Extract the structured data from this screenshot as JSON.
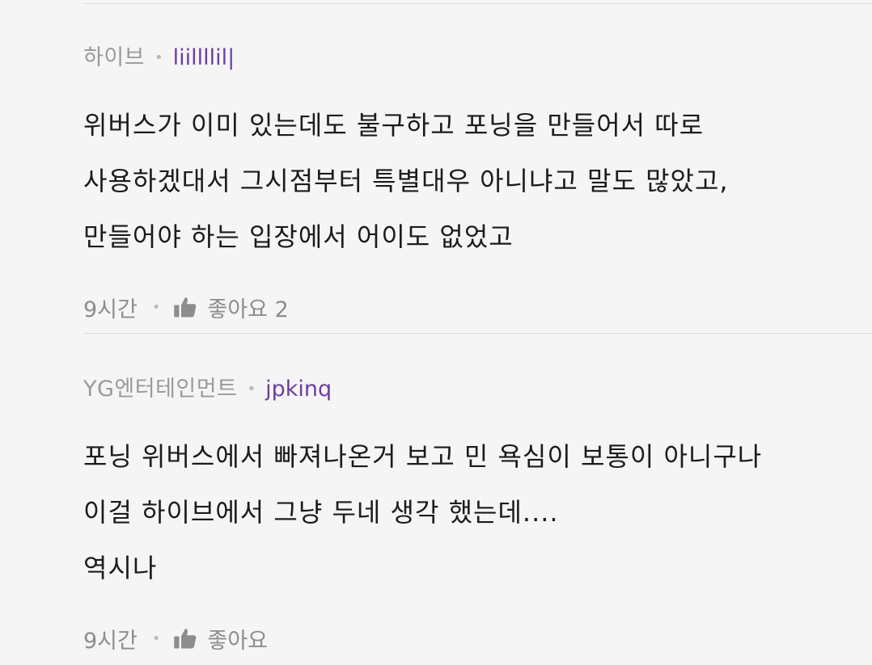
{
  "comments": [
    {
      "team": "하이브",
      "user": "liillllil|",
      "lines": [
        "위버스가 이미 있는데도 불구하고 포닝을 만들어서 따로",
        "사용하겠대서 그시점부터 특별대우 아니냐고 말도 많았고,",
        "만들어야 하는 입장에서 어이도 없었고"
      ],
      "time": "9시간",
      "like_label": "좋아요 2"
    },
    {
      "team": "YG엔터테인먼트",
      "user": "jpkinq",
      "lines": [
        "포닝 위버스에서 빠져나온거 보고 민 욕심이 보통이 아니구나",
        "이걸 하이브에서 그냥 두네 생각 했는데....",
        "역시나"
      ],
      "time": "9시간",
      "like_label": "좋아요"
    }
  ],
  "separator": "•",
  "colors": {
    "background": "#f5f5f5",
    "username": "#6c3fa0",
    "meta": "#9a9a9a",
    "body": "#1b1b1b"
  },
  "icons": {
    "like": "thumbs-up-icon"
  }
}
